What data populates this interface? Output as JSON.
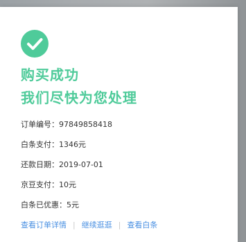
{
  "status": {
    "icon": "check-icon",
    "accent_color": "#4fcb9a",
    "title_line1": "购买成功",
    "title_line2": "我们尽快为您处理"
  },
  "order_info": [
    {
      "label": "订单编号：",
      "value": "97849858418"
    },
    {
      "label": "白条支付：",
      "value": "1346元"
    },
    {
      "label": "还款日期：",
      "value": "2019-07-01"
    },
    {
      "label": "京豆支付：",
      "value": "10元"
    },
    {
      "label": "白条已优惠：",
      "value": "5元"
    }
  ],
  "links": {
    "order_detail": "查看订单详情",
    "continue_shopping": "继续逛逛",
    "view_baitiao": "查看白条",
    "separator": "|",
    "link_color": "#4a90e2"
  }
}
